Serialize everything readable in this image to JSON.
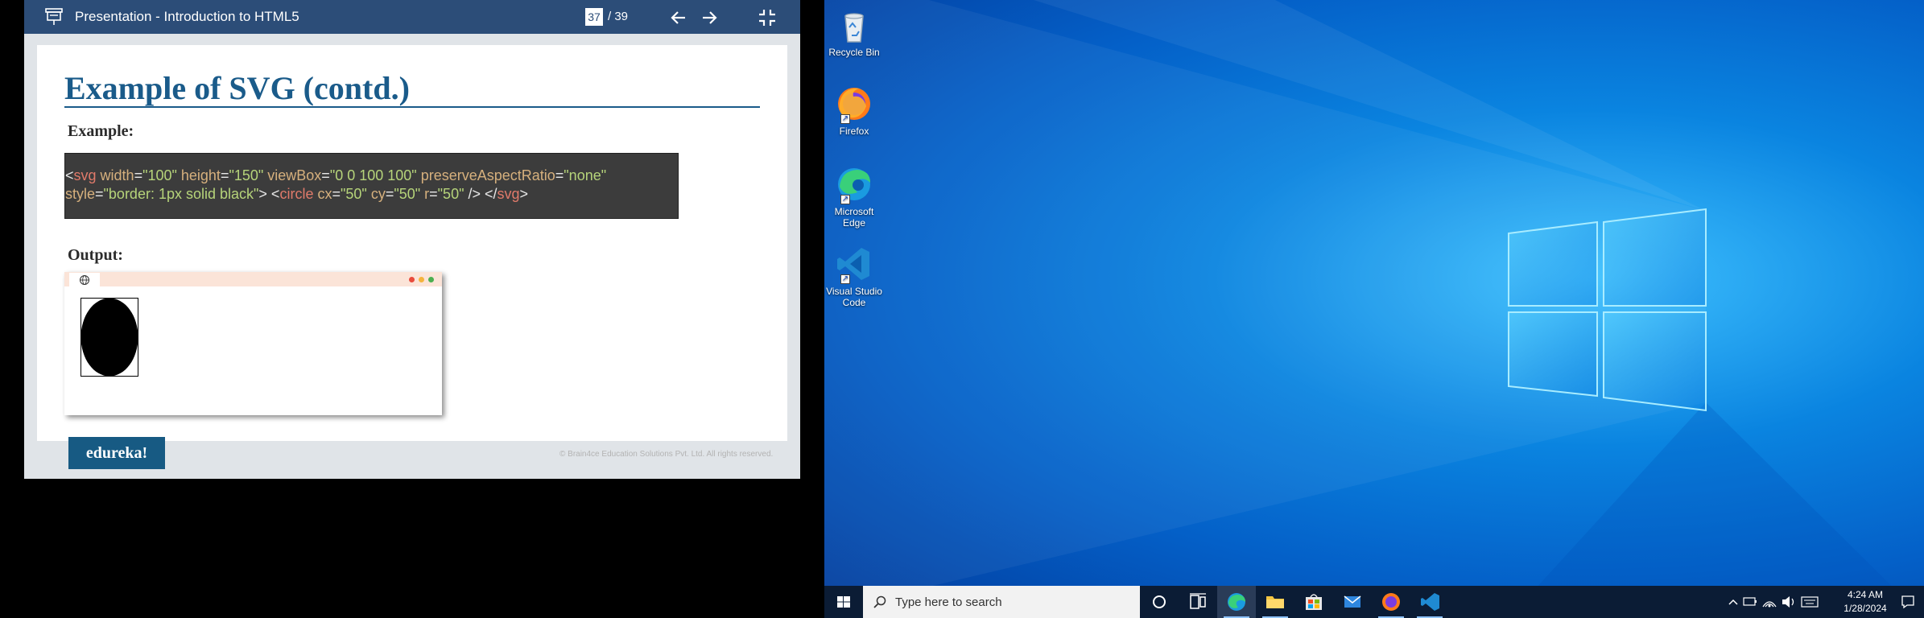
{
  "presentation": {
    "window_title": "Presentation - Introduction to HTML5",
    "current_page": "37",
    "page_total": "/ 39",
    "icons": {
      "app": "presentation-icon",
      "prev": "arrow-left-icon",
      "next": "arrow-right-icon",
      "exit": "exit-fullscreen-icon"
    },
    "colors": {
      "title_bar": "#2c4d78",
      "slide_title": "#1a5b8a",
      "brand": "#175a83"
    }
  },
  "slide": {
    "title": "Example of SVG (contd.)",
    "example_label": "Example:",
    "code": {
      "line1": [
        {
          "t": "<",
          "c": "w"
        },
        {
          "t": "svg",
          "c": "t"
        },
        {
          "t": " width",
          "c": "a"
        },
        {
          "t": "=",
          "c": "w"
        },
        {
          "t": "\"100\"",
          "c": "v"
        },
        {
          "t": " height",
          "c": "a"
        },
        {
          "t": "=",
          "c": "w"
        },
        {
          "t": "\"150\"",
          "c": "v"
        },
        {
          "t": " viewBox",
          "c": "a"
        },
        {
          "t": "=",
          "c": "w"
        },
        {
          "t": "\"0 0 100 100\"",
          "c": "v"
        },
        {
          "t": " preserveAspectRatio",
          "c": "a"
        },
        {
          "t": "=",
          "c": "w"
        },
        {
          "t": "\"none\"",
          "c": "v"
        }
      ],
      "line2": [
        {
          "t": "style",
          "c": "a"
        },
        {
          "t": "=",
          "c": "w"
        },
        {
          "t": "\"border: 1px solid black\"",
          "c": "v"
        },
        {
          "t": "> <",
          "c": "w"
        },
        {
          "t": "circle",
          "c": "t"
        },
        {
          "t": " cx",
          "c": "a"
        },
        {
          "t": "=",
          "c": "w"
        },
        {
          "t": "\"50\"",
          "c": "v"
        },
        {
          "t": " cy",
          "c": "a"
        },
        {
          "t": "=",
          "c": "w"
        },
        {
          "t": "\"50\"",
          "c": "v"
        },
        {
          "t": " r",
          "c": "a"
        },
        {
          "t": "=",
          "c": "w"
        },
        {
          "t": "\"50\"",
          "c": "v"
        },
        {
          "t": " /> </",
          "c": "w"
        },
        {
          "t": "svg",
          "c": "t"
        },
        {
          "t": ">",
          "c": "w"
        }
      ]
    },
    "output_label": "Output:",
    "brand": "edureka!",
    "copyright": "© Brain4ce Education Solutions Pvt. Ltd. All rights reserved."
  },
  "desktop": {
    "icons": [
      {
        "label": "Recycle Bin",
        "icon": "recycle-bin-icon"
      },
      {
        "label": "Firefox",
        "icon": "firefox-icon"
      },
      {
        "label": "Microsoft Edge",
        "icon": "edge-icon"
      },
      {
        "label": "Visual Studio Code",
        "icon": "vscode-icon"
      }
    ]
  },
  "taskbar": {
    "search_placeholder": "Type here to search",
    "apps": [
      "cortana-icon",
      "task-view-icon",
      "edge-icon",
      "file-explorer-icon",
      "store-icon",
      "mail-icon",
      "firefox-icon",
      "vscode-icon"
    ],
    "time": "4:24 AM",
    "date": "1/28/2024"
  }
}
